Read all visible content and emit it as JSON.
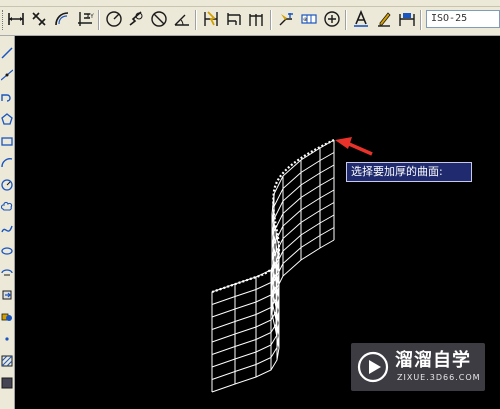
{
  "toolbar": {
    "dimension_style": "ISO-25",
    "buttons": [
      "linear-dimension-icon",
      "aligned-dimension-icon",
      "arc-length-dimension-icon",
      "ordinate-dimension-icon",
      "radius-dimension-icon",
      "jogged-dimension-icon",
      "diameter-dimension-icon",
      "angular-dimension-icon",
      "quick-dimension-icon",
      "baseline-dimension-icon",
      "continue-dimension-icon",
      "quick-leader-icon",
      "tolerance-icon",
      "center-mark-icon",
      "dimension-edit-icon",
      "dimension-text-edit-icon",
      "dimension-update-icon"
    ]
  },
  "left_toolbar": {
    "buttons": [
      "line-icon",
      "construction-line-icon",
      "polyline-icon",
      "polygon-icon",
      "rectangle-icon",
      "arc-icon",
      "circle-icon",
      "revision-cloud-icon",
      "spline-icon",
      "ellipse-icon",
      "ellipse-arc-icon",
      "insert-block-icon",
      "make-block-icon",
      "point-icon",
      "hatch-icon",
      "gradient-icon"
    ]
  },
  "canvas": {
    "background": "#000000",
    "wire_color": "#ffffff",
    "arrow_color": "#e8322a",
    "prompt_tooltip": "选择要加厚的曲面:"
  },
  "watermark": {
    "title": "溜溜自学",
    "subtitle": "ZIXUE.3D66.COM"
  }
}
